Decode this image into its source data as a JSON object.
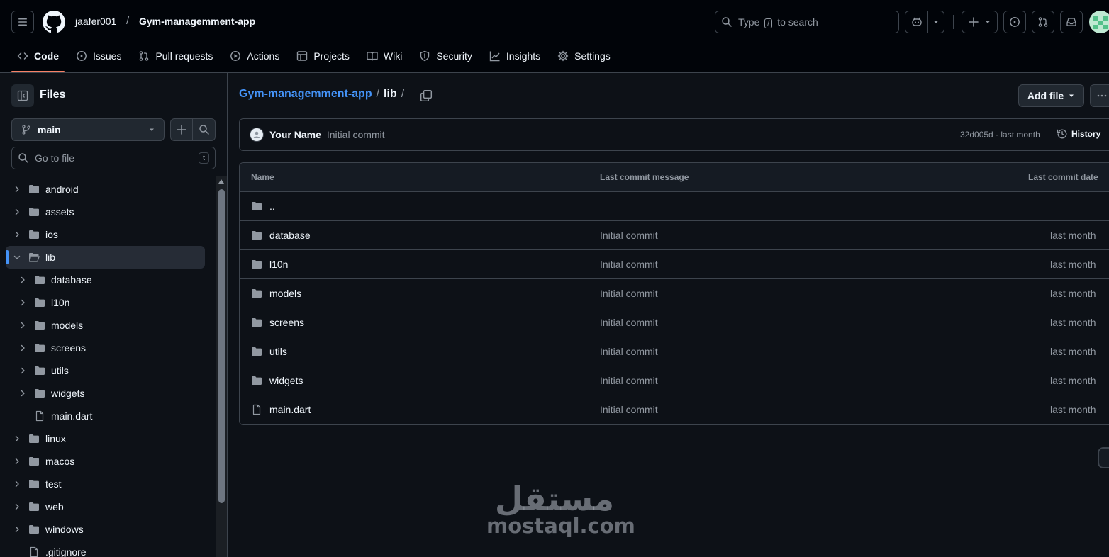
{
  "header": {
    "owner": "jaafer001",
    "separator": "/",
    "repo": "Gym-managemment-app",
    "search": {
      "prefix": "Type",
      "key": "/",
      "suffix": "to search"
    }
  },
  "tabs": [
    {
      "label": "Code",
      "icon": "code-icon",
      "selected": true
    },
    {
      "label": "Issues",
      "icon": "issue-opened-icon"
    },
    {
      "label": "Pull requests",
      "icon": "git-pull-request-icon"
    },
    {
      "label": "Actions",
      "icon": "play-icon"
    },
    {
      "label": "Projects",
      "icon": "table-icon"
    },
    {
      "label": "Wiki",
      "icon": "book-icon"
    },
    {
      "label": "Security",
      "icon": "shield-icon"
    },
    {
      "label": "Insights",
      "icon": "graph-icon"
    },
    {
      "label": "Settings",
      "icon": "gear-icon"
    }
  ],
  "sidebar": {
    "title": "Files",
    "branch": "main",
    "goto_placeholder": "Go to file",
    "goto_key": "t",
    "tree": [
      {
        "name": "android",
        "type": "dir",
        "level": 0,
        "expanded": false
      },
      {
        "name": "assets",
        "type": "dir",
        "level": 0,
        "expanded": false
      },
      {
        "name": "ios",
        "type": "dir",
        "level": 0,
        "expanded": false
      },
      {
        "name": "lib",
        "type": "dir",
        "level": 0,
        "expanded": true,
        "active": true
      },
      {
        "name": "database",
        "type": "dir",
        "level": 1,
        "expanded": false
      },
      {
        "name": "l10n",
        "type": "dir",
        "level": 1,
        "expanded": false
      },
      {
        "name": "models",
        "type": "dir",
        "level": 1,
        "expanded": false
      },
      {
        "name": "screens",
        "type": "dir",
        "level": 1,
        "expanded": false
      },
      {
        "name": "utils",
        "type": "dir",
        "level": 1,
        "expanded": false
      },
      {
        "name": "widgets",
        "type": "dir",
        "level": 1,
        "expanded": false
      },
      {
        "name": "main.dart",
        "type": "file",
        "level": 1
      },
      {
        "name": "linux",
        "type": "dir",
        "level": 0,
        "expanded": false
      },
      {
        "name": "macos",
        "type": "dir",
        "level": 0,
        "expanded": false
      },
      {
        "name": "test",
        "type": "dir",
        "level": 0,
        "expanded": false
      },
      {
        "name": "web",
        "type": "dir",
        "level": 0,
        "expanded": false
      },
      {
        "name": "windows",
        "type": "dir",
        "level": 0,
        "expanded": false
      },
      {
        "name": ".gitignore",
        "type": "file",
        "level": 0
      }
    ]
  },
  "main": {
    "breadcrumb": {
      "repo": "Gym-managemment-app",
      "sep1": "/",
      "current": "lib",
      "sep2": "/"
    },
    "add_file_label": "Add file",
    "commit": {
      "author": "Your Name",
      "message": "Initial commit",
      "meta": "32d005d · last month",
      "history_label": "History"
    },
    "table": {
      "headers": {
        "name": "Name",
        "message": "Last commit message",
        "date": "Last commit date"
      },
      "rows": [
        {
          "name": "..",
          "type": "dir",
          "message": "",
          "date": ""
        },
        {
          "name": "database",
          "type": "dir",
          "message": "Initial commit",
          "date": "last month"
        },
        {
          "name": "l10n",
          "type": "dir",
          "message": "Initial commit",
          "date": "last month"
        },
        {
          "name": "models",
          "type": "dir",
          "message": "Initial commit",
          "date": "last month"
        },
        {
          "name": "screens",
          "type": "dir",
          "message": "Initial commit",
          "date": "last month"
        },
        {
          "name": "utils",
          "type": "dir",
          "message": "Initial commit",
          "date": "last month"
        },
        {
          "name": "widgets",
          "type": "dir",
          "message": "Initial commit",
          "date": "last month"
        },
        {
          "name": "main.dart",
          "type": "file",
          "message": "Initial commit",
          "date": "last month"
        }
      ]
    }
  },
  "watermark": {
    "arabic": "مستقل",
    "latin": "mostaql.com"
  },
  "colors": {
    "background": "#0d1117",
    "header": "#010409",
    "border": "#3d444d",
    "link": "#4493f8",
    "tab_underline": "#f78166",
    "muted": "#9198a1"
  }
}
